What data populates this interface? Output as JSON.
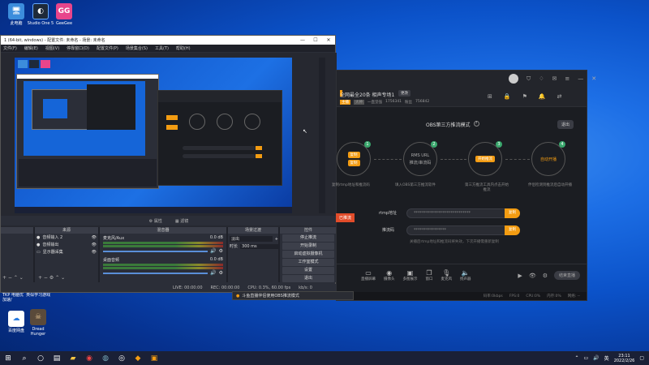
{
  "desktop": {
    "icons_top": [
      {
        "label": "此电脑",
        "icon": "computer-icon"
      },
      {
        "label": "Studio One 5",
        "icon": "studio-one-icon"
      },
      {
        "label": "GeeGee",
        "icon": "geegee-icon"
      }
    ],
    "icons_bottom": [
      {
        "label": "百度网盘",
        "icon": "baidu-netdisk-icon"
      },
      {
        "label": "Dread Hunger",
        "icon": "dread-hunger-icon"
      }
    ],
    "widget_label_1": "TKP 电脑优",
    "widget_label_2": "类似学习游戏",
    "widget_label_3": "加速/"
  },
  "obs": {
    "title": "1 (64-bit, windows) - 配置文件: 未命名 - 场景: 未命名",
    "menu": [
      "文件(F)",
      "编辑(E)",
      "视图(V)",
      "停靠窗口(D)",
      "配置文件(P)",
      "场景集合(S)",
      "工具(T)",
      "帮助(H)"
    ],
    "scene_tabs": [
      "属性",
      "滤镜"
    ],
    "docks": {
      "scenes": {
        "title": "",
        "items": []
      },
      "sources": {
        "title": "来源",
        "items": [
          "音频输入 2",
          "音频输出",
          "显示器采集"
        ]
      },
      "mixer": {
        "title": "混音器",
        "tracks": [
          {
            "name": "麦克风/Aux",
            "db": "0.0 dB"
          },
          {
            "name": "桌面音频",
            "db": "0.0 dB"
          }
        ]
      },
      "transitions": {
        "title": "场景过渡",
        "type": "淡出",
        "duration_label": "时长",
        "duration": "300 ms"
      },
      "controls": {
        "title": "控件",
        "buttons": [
          "停止推流",
          "开始录制",
          "启动虚拟摄像机",
          "工作室模式",
          "设置",
          "退出"
        ]
      }
    },
    "status": {
      "live": "LIVE: 00:00:00",
      "rec": "REC: 00:00:00",
      "cpu": "CPU: 0.3%, 60.00 fps",
      "kbps": "kb/s: 0"
    }
  },
  "notification": {
    "text": "斗鱼直播伴侣使用OBS推流模式",
    "badge": "已推流"
  },
  "tool": {
    "title": "全网最全20条 相声专场1",
    "tag": "更改",
    "sub_labels": [
      "主播",
      "大神",
      "一直坚强",
      "1756341",
      "粉丝",
      "756842"
    ],
    "mode_title": "OBS第三方推流模式",
    "mode_help": "?",
    "exit_btn": "退出",
    "steps": [
      {
        "num": "1",
        "label": "",
        "btn1": "复制",
        "btn2": "复制",
        "caption": "复制rtmp地址和推流码"
      },
      {
        "num": "2",
        "label": "RMS URL",
        "label2": "推流/串流码",
        "caption": "填入OBS第三方推流软件"
      },
      {
        "num": "3",
        "label": "",
        "btn1": "开始推流",
        "caption": "第三方推流工具内点击开始推流"
      },
      {
        "num": "4",
        "label": "自动开播",
        "caption": "伴侣检测到推流后自动开播"
      }
    ],
    "rtmp_label": "rtmp地址",
    "rtmp_value": "****************************",
    "rtmp_btn": "复制",
    "key_label": "推流码",
    "key_value": "****************",
    "key_btn": "复制",
    "hint": "关播后rtmp地址和推流码将失效，下次开播需重新复制",
    "toolbar": [
      {
        "icon": "screen-icon",
        "label": "直播屏幕"
      },
      {
        "icon": "camera-icon",
        "label": "摄像头"
      },
      {
        "icon": "image-icon",
        "label": "多图展示"
      },
      {
        "icon": "window-icon",
        "label": "窗口"
      },
      {
        "icon": "mic-icon",
        "label": "麦克风"
      },
      {
        "icon": "speaker-icon",
        "label": "扬声器"
      }
    ],
    "status_items": [
      "码率:0kbps",
      "FPS:0",
      "CPU:0%",
      "内存:0%",
      "网络: --"
    ],
    "end_btn": "结束直播"
  },
  "taskbar": {
    "apps": [
      "start-icon",
      "search-icon",
      "taskview-icon",
      "explorer-icon",
      "chrome-icon",
      "steam-icon",
      "obs-icon",
      "douyu-icon",
      "app-icon"
    ],
    "time": "23:11",
    "date": "2022/2/26",
    "ime": "英"
  },
  "colors": {
    "accent": "#f39c12",
    "obs_bg": "#2b2e38",
    "tool_bg": "#1b1d22",
    "desktop_blue": "#0b52c9"
  }
}
